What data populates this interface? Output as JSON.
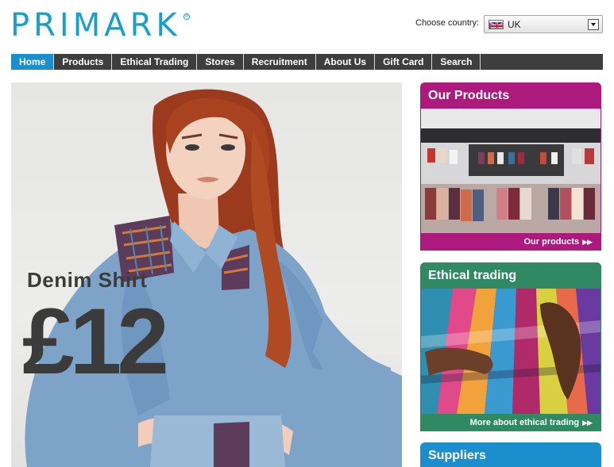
{
  "header": {
    "logo_text": "PRIMARK",
    "logo_mark": "®",
    "country_label": "Choose country:",
    "country_value": "UK",
    "country_flag_icon": "uk-flag-icon"
  },
  "nav": {
    "items": [
      {
        "label": "Home",
        "active": true
      },
      {
        "label": "Products",
        "active": false
      },
      {
        "label": "Ethical Trading",
        "active": false
      },
      {
        "label": "Stores",
        "active": false
      },
      {
        "label": "Recruitment",
        "active": false
      },
      {
        "label": "About Us",
        "active": false
      },
      {
        "label": "Gift Card",
        "active": false
      },
      {
        "label": "Search",
        "active": false
      }
    ]
  },
  "hero": {
    "title": "Denim Shirt",
    "price": "£12"
  },
  "sidebar": {
    "products": {
      "title": "Our Products",
      "link": "Our products",
      "arrow": "▶▶",
      "color": "#ad1a7d"
    },
    "ethical": {
      "title": "Ethical trading",
      "link": "More about ethical trading",
      "arrow": "▶▶",
      "color": "#2f8a63"
    },
    "suppliers": {
      "title": "Suppliers",
      "color": "#1b8fcd"
    }
  },
  "colors": {
    "brand": "#1aa0c8",
    "nav_bg": "#3e3e3e",
    "nav_active": "#1b8fcd"
  }
}
